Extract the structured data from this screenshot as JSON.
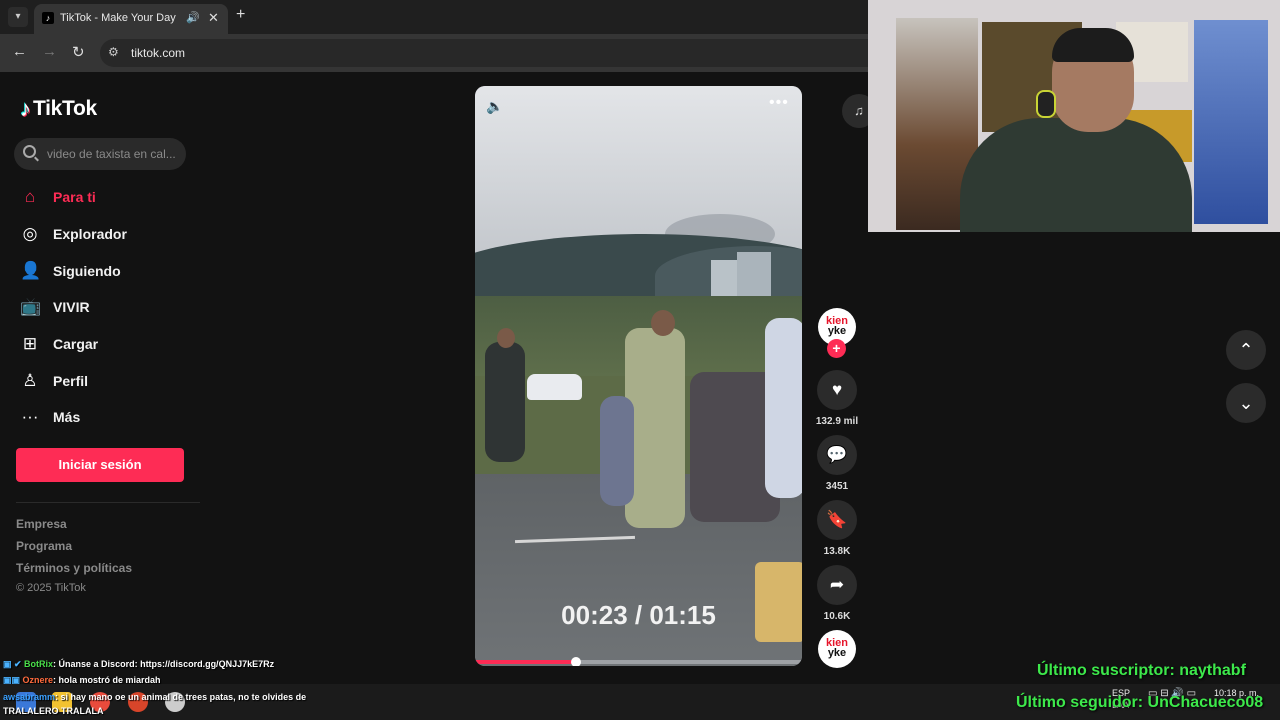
{
  "browser": {
    "tab_title": "TikTok - Make Your Day",
    "url": "tiktok.com",
    "icons": [
      "tab-dropdown-icon",
      "audio-icon",
      "close-icon",
      "plus-icon",
      "back-icon",
      "forward-icon",
      "reload-icon",
      "site-settings-icon"
    ]
  },
  "sidebar": {
    "logo": "TikTok",
    "search_placeholder": "video de taxista en cal...",
    "items": [
      {
        "label": "Para ti",
        "icon": "home-icon",
        "active": true
      },
      {
        "label": "Explorador",
        "icon": "compass-icon"
      },
      {
        "label": "Siguiendo",
        "icon": "following-icon"
      },
      {
        "label": "VIVIR",
        "icon": "live-tv-icon"
      },
      {
        "label": "Cargar",
        "icon": "upload-icon"
      },
      {
        "label": "Perfil",
        "icon": "profile-icon"
      },
      {
        "label": "Más",
        "icon": "more-icon"
      }
    ],
    "login_label": "Iniciar sesión",
    "footer_links": [
      "Empresa",
      "Programa",
      "Términos y políticas"
    ],
    "copyright": "© 2025 TikTok"
  },
  "video": {
    "time_overlay": "00:23 / 01:15",
    "progress": 0.31,
    "accent": "#fe2c55"
  },
  "actions": {
    "author_brand": "kienyke",
    "likes": "132.9 mil",
    "comments": "3451",
    "saves": "13.8K",
    "shares": "10.6K"
  },
  "stream_overlay": {
    "chat": [
      {
        "user": "BotRix",
        "text": ": Únanse a Discord: https://discord.gg/QNJJ7kE7Rz"
      },
      {
        "user": "Oznere",
        "text": ": hola mostró de miardah"
      },
      {
        "user": "awsabramm",
        "text": ": si hay mano oe un animal de trees patas, no te olvides de"
      },
      {
        "user": "",
        "text": "TRALALERO TRALALA"
      }
    ],
    "last_subscriber": "Último suscriptor: naythabf",
    "last_follower": "Último seguidor: UnChacueco08",
    "tray_lang": "ESP",
    "tray_lang2": "LAA",
    "clock_time": "10:18 p. m."
  }
}
